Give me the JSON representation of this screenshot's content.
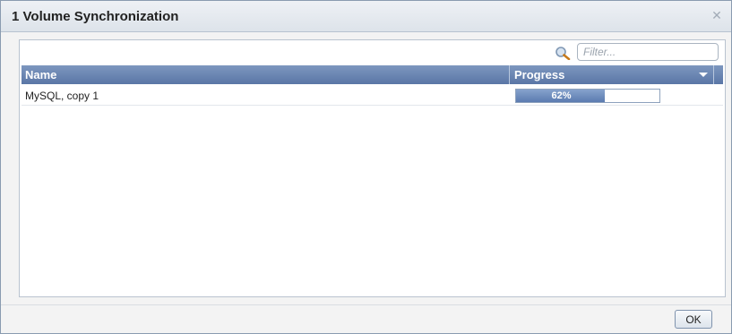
{
  "dialog": {
    "title": "1 Volume Synchronization",
    "close_icon": "close-icon"
  },
  "filter": {
    "icon": "search-icon",
    "placeholder": "Filter...",
    "value": ""
  },
  "table": {
    "columns": [
      {
        "label": "Name"
      },
      {
        "label": "Progress",
        "icon": "chevron-down-icon"
      }
    ],
    "rows": [
      {
        "name": "MySQL, copy 1",
        "progress_label": "62%",
        "progress": 0.62
      }
    ]
  },
  "footer": {
    "ok_label": "OK"
  },
  "colors": {
    "header_bg": "#6b86b3",
    "progress_fill": "#6f8fc2",
    "border": "#8a9bb0"
  }
}
